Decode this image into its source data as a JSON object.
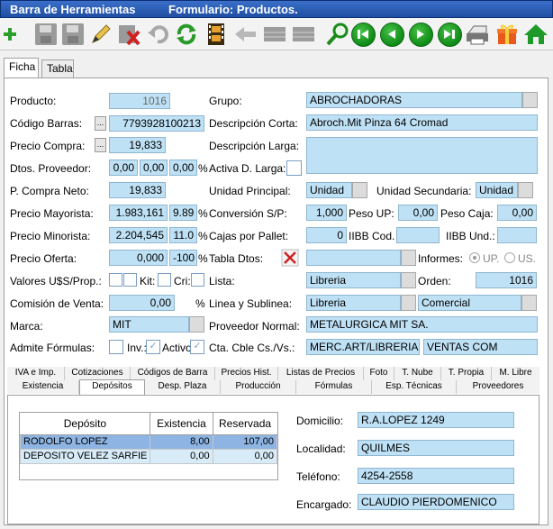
{
  "window": {
    "title_left": "Barra de Herramientas",
    "title_right": "Formulario: Productos."
  },
  "toolbar": {
    "icons": [
      "add-icon",
      "save-icon",
      "save-as-icon",
      "edit-icon",
      "delete-icon",
      "undo-icon",
      "refresh-icon",
      "film-icon",
      "back-arrow-icon",
      "grid-icon",
      "grid-icon",
      "search-icon",
      "first-icon",
      "prev-icon",
      "next-icon",
      "last-icon",
      "print-icon",
      "gift-icon",
      "home-icon"
    ]
  },
  "tabs": [
    "Ficha",
    "Tabla"
  ],
  "form": {
    "producto_label": "Producto:",
    "producto": "1016",
    "grupo_label": "Grupo:",
    "grupo": "ABROCHADORAS",
    "codigo_barras_label": "Código Barras:",
    "codigo_barras": "7793928100213",
    "desc_corta_label": "Descripción Corta:",
    "desc_corta": "Abroch.Mit Pinza 64 Cromad",
    "precio_compra_label": "Precio Compra:",
    "precio_compra": "19,833",
    "desc_larga_label": "Descripción Larga:",
    "desc_larga": "",
    "dtos_proveedor_label": "Dtos. Proveedor:",
    "dto1": "0,00",
    "dto2": "0,00",
    "dto3": "0,00",
    "pct": "%",
    "activa_d_larga_label": "Activa D. Larga:",
    "p_compra_neto_label": "P. Compra Neto:",
    "p_compra_neto": "19,833",
    "unidad_principal_label": "Unidad Principal:",
    "unidad_principal": "Unidad",
    "unidad_secundaria_label": "Unidad Secundaria:",
    "unidad_secundaria": "Unidad",
    "precio_mayorista_label": "Precio Mayorista:",
    "precio_mayorista": "1.983,161",
    "pct_mayorista": "9.89",
    "conversion_label": "Conversión S/P:",
    "conversion": "1,000",
    "peso_up_label": "Peso UP:",
    "peso_up": "0,00",
    "peso_caja_label": "Peso Caja:",
    "peso_caja": "0,00",
    "precio_minorista_label": "Precio Minorista:",
    "precio_minorista": "2.204,545",
    "pct_minorista": "11.0",
    "cajas_pallet_label": "Cajas por Pallet:",
    "cajas_pallet": "0",
    "iibb_cod_label": "IIBB Cod.",
    "iibb_cod": "",
    "iibb_und_label": "IIBB Und.:",
    "iibb_und": "",
    "precio_oferta_label": "Precio Oferta:",
    "precio_oferta": "0,000",
    "pct_oferta": "-100",
    "tabla_dtos_label": "Tabla Dtos:",
    "informes_label": "Informes:",
    "informes_up": "UP.",
    "informes_us": "US.",
    "valores_label": "Valores U$S/Prop.:",
    "kit_label": "Kit:",
    "cri_label": "Cri:",
    "lista_label": "Lista:",
    "lista": "Libreria",
    "orden_label": "Orden:",
    "orden": "1016",
    "comision_label": "Comisión de Venta:",
    "comision": "0,00",
    "linea_label": "Linea y Sublinea:",
    "linea": "Libreria",
    "sublinea": "Comercial",
    "marca_label": "Marca:",
    "marca": "MIT",
    "proveedor_label": "Proveedor Normal:",
    "proveedor": "METALURGICA MIT SA.",
    "admite_label": "Admite Fórmulas:",
    "inv_label": "Inv.:",
    "activo_label": "Activo",
    "cta_label": "Cta. Cble Cs./Vs.:",
    "cta1": "MERC.ART/LIBRERIA",
    "cta2": "VENTAS COM"
  },
  "subtabs_row1": [
    "IVA e Imp.",
    "Cotizaciones",
    "Códigos de Barra",
    "Precios Hist.",
    "Listas de Precios",
    "Foto",
    "T. Nube",
    "T. Propia",
    "M. Libre"
  ],
  "subtabs_row2": [
    "Existencia",
    "Depósitos",
    "Desp. Plaza",
    "Producción",
    "Fórmulas",
    "Esp. Técnicas",
    "Proveedores"
  ],
  "depositos": {
    "columns": [
      "Depósito",
      "Existencia",
      "Reservada"
    ],
    "rows": [
      [
        "RODOLFO LOPEZ",
        "8,00",
        "107,00"
      ],
      [
        "DEPOSITO VELEZ SARFIE",
        "0,00",
        "0,00"
      ]
    ],
    "domicilio_label": "Domicilio:",
    "domicilio": "R.A.LOPEZ 1249",
    "localidad_label": "Localidad:",
    "localidad": "QUILMES",
    "telefono_label": "Teléfono:",
    "telefono": "4254-2558",
    "encargado_label": "Encargado:",
    "encargado": "CLAUDIO PIERDOMENICO"
  }
}
